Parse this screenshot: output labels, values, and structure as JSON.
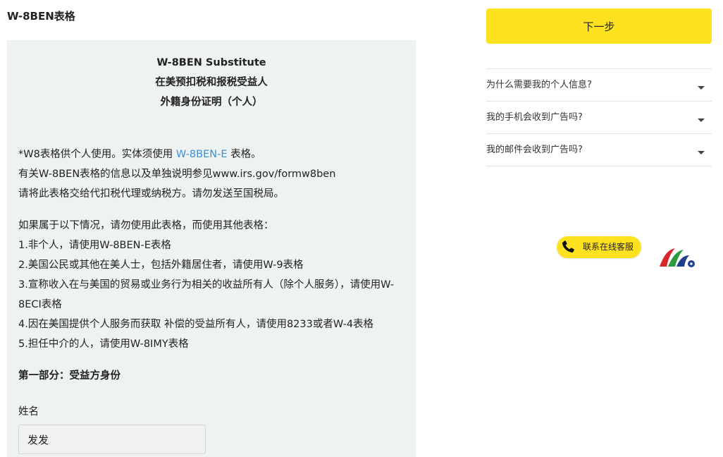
{
  "page": {
    "title": "W-8BEN表格"
  },
  "form": {
    "heading_line1": "W-8BEN Substitute",
    "heading_line2": "在美预扣税和报税受益人",
    "heading_line3": "外籍身份证明（个人）",
    "intro": {
      "line1_prefix": "*W8表格供个人使用。实体须使用 ",
      "line1_link": "W-8BEN-E",
      "line1_suffix": " 表格。",
      "line2": "有关W-8BEN表格的信息以及单独说明参见www.irs.gov/formw8ben",
      "line3": "请将此表格交给代扣税代理或纳税方。请勿发送至国税局。"
    },
    "conditions": {
      "intro": "如果属于以下情况，请勿使用此表格，而使用其他表格：",
      "items": [
        "1.非个人，请使用W-8BEN-E表格",
        "2.美国公民或其他在美人士，包括外籍居住者，请使用W-9表格",
        "3.宣称收入在与美国的贸易或业务行为相关的收益所有人（除个人服务），请使用W-8ECI表格",
        "4.因在美国提供个人服务而获取 补偿的受益所有人，请使用8233或者W-4表格",
        "5.担任中介的人，请使用W-8IMY表格"
      ]
    },
    "section_title": "第一部分：受益方身份",
    "name_label": "姓名",
    "name_value": "发发"
  },
  "sidebar": {
    "next_button": "下一步",
    "faq": [
      "为什么需要我的个人信息?",
      "我的手机会收到广告吗?",
      "我的邮件会收到广告吗?"
    ],
    "support_label": "联系在线客服",
    "support_icon": "phone-icon",
    "logo_icon": "brand-logo"
  },
  "colors": {
    "accent_yellow": "#ffe21f",
    "link_blue": "#3a8fd6",
    "panel_bg": "#eef2f0"
  }
}
